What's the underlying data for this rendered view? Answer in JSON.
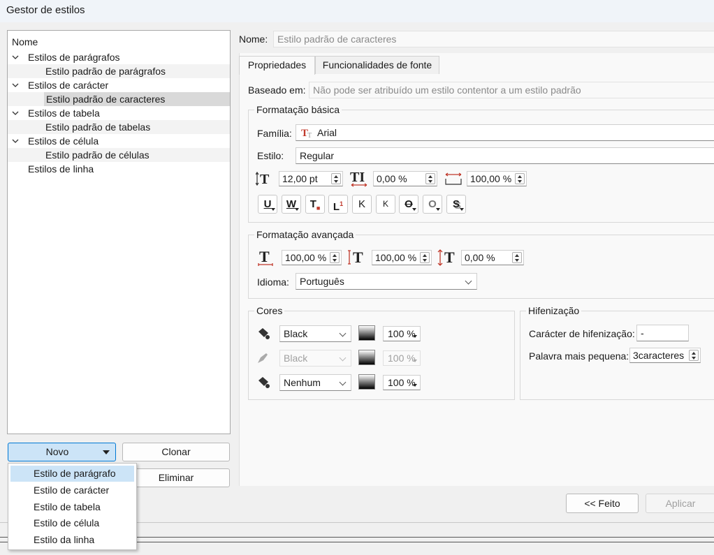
{
  "window": {
    "title": "Gestor de estilos"
  },
  "tree": {
    "header": "Nome",
    "groups": [
      {
        "label": "Estilos de parágrafos",
        "child": "Estilo padrão de parágrafos"
      },
      {
        "label": "Estilos de carácter",
        "child": "Estilo padrão de caracteres"
      },
      {
        "label": "Estilos de tabela",
        "child": "Estilo padrão de tabelas"
      },
      {
        "label": "Estilos de célula",
        "child": "Estilo padrão de células"
      }
    ],
    "line_styles": "Estilos de linha"
  },
  "buttons": {
    "novo": "Novo",
    "clonar": "Clonar",
    "eliminar": "Eliminar",
    "feito": "<< Feito",
    "aplicar": "Aplicar"
  },
  "new_menu": {
    "items": [
      "Estilo de parágrafo",
      "Estilo de carácter",
      "Estilo de tabela",
      "Estilo de célula",
      "Estilo da linha"
    ]
  },
  "name": {
    "label": "Nome:",
    "value": "Estilo padrão de caracteres"
  },
  "tabs": [
    "Propriedades",
    "Funcionalidades de fonte"
  ],
  "based_on": {
    "label": "Baseado em:",
    "value": "Não pode ser atribuído um estilo contentor a um estilo padrão"
  },
  "basic": {
    "title": "Formatação básica",
    "family_label": "Família:",
    "family_value": "Arial",
    "style_label": "Estilo:",
    "style_value": "Regular",
    "size": "12,00 pt",
    "tracking": "0,00 %",
    "scale": "100,00 %"
  },
  "advanced": {
    "title": "Formatação avançada",
    "hscale": "100,00 %",
    "vscale": "100,00 %",
    "baseline": "0,00 %",
    "language_label": "Idioma:",
    "language_value": "Português"
  },
  "colors": {
    "title": "Cores",
    "rows": [
      {
        "value": "Black",
        "pct": "100 %"
      },
      {
        "value": "Black",
        "pct": "100 %"
      },
      {
        "value": "Nenhum",
        "pct": "100 %"
      }
    ]
  },
  "hyphen": {
    "title": "Hifenização",
    "char_label": "Carácter de hifenização:",
    "char_value": "-",
    "word_label": "Palavra mais pequena:",
    "word_value": "3caracteres"
  },
  "format_buttons": [
    "U",
    "W",
    "T",
    "L",
    "K",
    "K",
    "O",
    "O",
    "S"
  ]
}
